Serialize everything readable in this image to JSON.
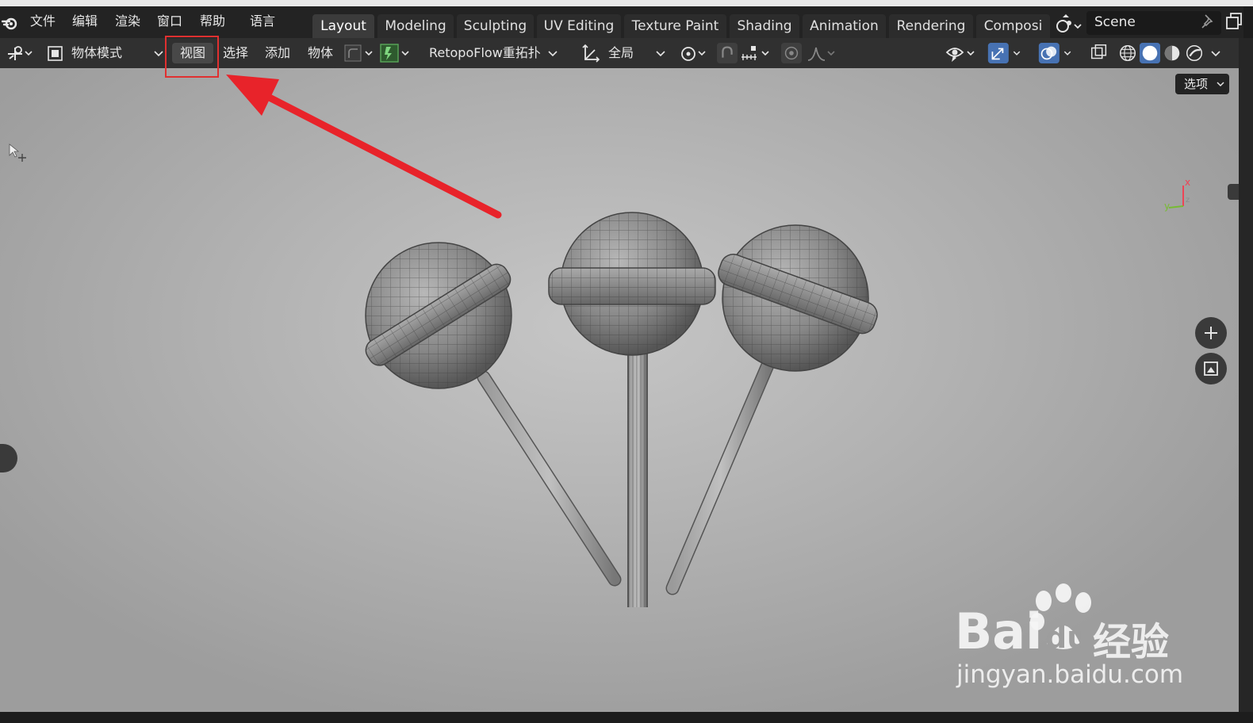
{
  "menubar": {
    "items": [
      "文件",
      "编辑",
      "渲染",
      "窗口",
      "帮助",
      "语言"
    ],
    "workspaces": [
      {
        "label": "Layout",
        "active": true
      },
      {
        "label": "Modeling",
        "active": false
      },
      {
        "label": "Sculpting",
        "active": false
      },
      {
        "label": "UV Editing",
        "active": false
      },
      {
        "label": "Texture Paint",
        "active": false
      },
      {
        "label": "Shading",
        "active": false
      },
      {
        "label": "Animation",
        "active": false
      },
      {
        "label": "Rendering",
        "active": false
      },
      {
        "label": "Composi",
        "active": false
      }
    ],
    "scene_name": "Scene"
  },
  "header": {
    "mode_label": "物体模式",
    "view_label": "视图",
    "select_label": "选择",
    "add_label": "添加",
    "object_label": "物体",
    "retopo_label": "RetopoFlow重拓扑",
    "transform_label": "全局"
  },
  "viewport": {
    "options_label": "选项",
    "axis_x": "x",
    "axis_y": "y",
    "axis_z": "z"
  },
  "watermark": {
    "brand_a": "Bai",
    "brand_b": "du",
    "brand_cn": "经验",
    "url": "jingyan.baidu.com"
  },
  "colors": {
    "accent": "#e03030",
    "active_tab": "#3b3b3b",
    "header_bg": "#303030"
  }
}
